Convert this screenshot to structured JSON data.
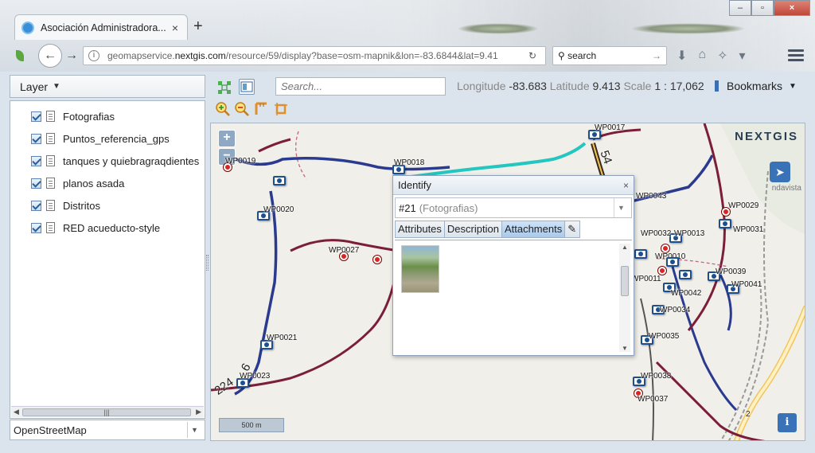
{
  "browser": {
    "tab_title": "Asociación Administradora...",
    "tab_close": "×",
    "new_tab": "+",
    "url_prefix": "geomapservice.",
    "url_domain": "nextgis.com",
    "url_rest": "/resource/59/display?base=osm-mapnik&lon=-83.6844&lat=9.41",
    "search_placeholder": "search",
    "window_controls": [
      "–",
      "▫",
      "×"
    ]
  },
  "sidebar": {
    "header": "Layer",
    "layers": [
      {
        "label": "Fotografias",
        "checked": true
      },
      {
        "label": "Puntos_referencia_gps",
        "checked": true
      },
      {
        "label": "tanques y quiebragraqdientes",
        "checked": true
      },
      {
        "label": "planos asada",
        "checked": true
      },
      {
        "label": "Distritos",
        "checked": true
      },
      {
        "label": "RED acueducto-style",
        "checked": true
      }
    ],
    "basemap": "OpenStreetMap"
  },
  "toolbar": {
    "search_placeholder": "Search...",
    "longitude_label": "Longitude",
    "longitude_value": "-83.683",
    "latitude_label": "Latitude",
    "latitude_value": "9.413",
    "scale_label": "Scale",
    "scale_value": "1 : 17,062",
    "bookmarks_label": "Bookmarks"
  },
  "map": {
    "logo": "NEXTGIS",
    "zoom_in": "+",
    "zoom_out": "−",
    "scale_bar": "500 m",
    "info_button": "i",
    "town_label": "ndavista",
    "road_labels": [
      "54",
      "224",
      "6",
      "2"
    ],
    "waypoints": [
      "WP0017",
      "WP0018",
      "WP0019",
      "WP0020",
      "WP0027",
      "WP0021",
      "WP0023",
      "WP0043",
      "WP0029",
      "WP0031",
      "WP0032",
      "WP0013",
      "WP0010",
      "WP0011",
      "WP0039",
      "WP0041",
      "WP0042",
      "WP0034",
      "WP0035",
      "WP0038",
      "WP0037"
    ]
  },
  "identify": {
    "title": "Identify",
    "close": "×",
    "feature_id": "#21",
    "feature_layer": "(Fotografias)",
    "tabs": [
      "Attributes",
      "Description",
      "Attachments"
    ],
    "active_tab": "Attachments"
  },
  "colors": {
    "road_main": "#2a3a8f",
    "road_secondary": "#7a1e3a",
    "water": "#23c7c0",
    "highway": "#f2c55c"
  }
}
